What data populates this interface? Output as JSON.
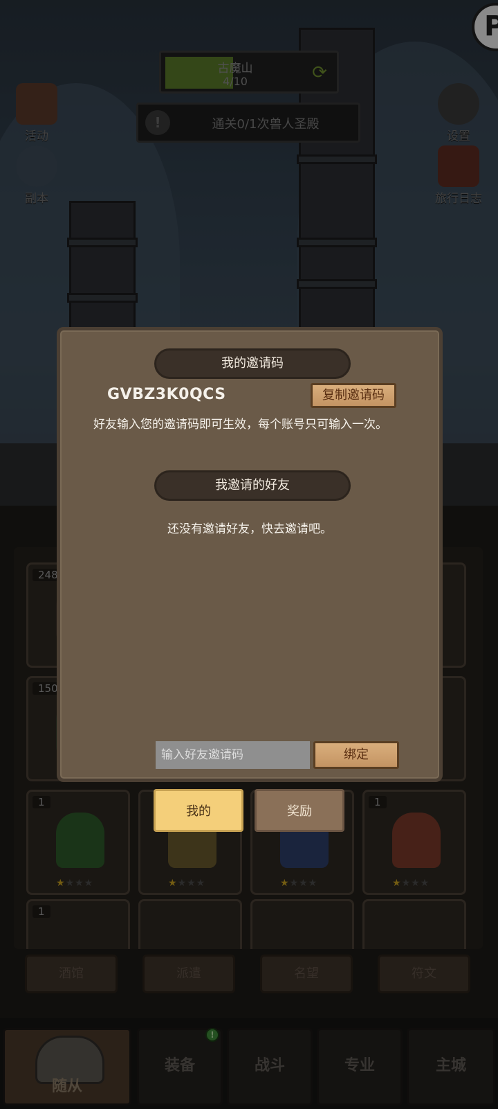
{
  "hud": {
    "stage_name": "古魔山",
    "stage_progress": "4/10",
    "stage_fill_fraction": 0.4,
    "quest_text": "通关0/1次兽人圣殿",
    "left_buttons": [
      {
        "label": "活动",
        "icon": "scroll-icon"
      },
      {
        "label": "副本",
        "icon": "portal-icon"
      }
    ],
    "right_buttons": [
      {
        "label": "设置",
        "icon": "gear-icon"
      },
      {
        "label": "旅行日志",
        "icon": "journal-icon"
      }
    ],
    "corner_badge": "P"
  },
  "roster": {
    "slots": [
      {
        "count": "248"
      },
      {
        "count": ""
      },
      {
        "count": ""
      },
      {
        "count": ""
      },
      {
        "count": "150"
      },
      {
        "count": ""
      },
      {
        "count": ""
      },
      {
        "count": ""
      },
      {
        "count": "1",
        "stars": "★"
      },
      {
        "count": "",
        "stars": "★"
      },
      {
        "count": "",
        "stars": "★"
      },
      {
        "count": "1",
        "stars": "★"
      },
      {
        "count": "1"
      },
      {
        "count": ""
      },
      {
        "count": ""
      },
      {
        "count": ""
      }
    ],
    "tabs": [
      "酒馆",
      "派遣",
      "名望",
      "符文"
    ]
  },
  "dialog": {
    "my_code_header": "我的邀请码",
    "code": "GVBZ3K0QCS",
    "copy_button": "复制邀请码",
    "description": "好友输入您的邀请码即可生效，每个账号只可输入一次。",
    "friends_header": "我邀请的好友",
    "empty_text": "还没有邀请好友，快去邀请吧。",
    "input_placeholder": "输入好友邀请码",
    "bind_button": "绑定",
    "tabs": {
      "mine": "我的",
      "rewards": "奖励"
    },
    "active_tab": "我的"
  },
  "bottom_nav": {
    "items": [
      "随从",
      "装备",
      "战斗",
      "专业",
      "主城"
    ],
    "active": "随从",
    "badge": "!"
  },
  "colors": {
    "dialog_bg": "#6a5a48",
    "header_pill": "#3a3028",
    "wood_button": "#d9ae7c",
    "active_tab": "#f4cf7a"
  }
}
